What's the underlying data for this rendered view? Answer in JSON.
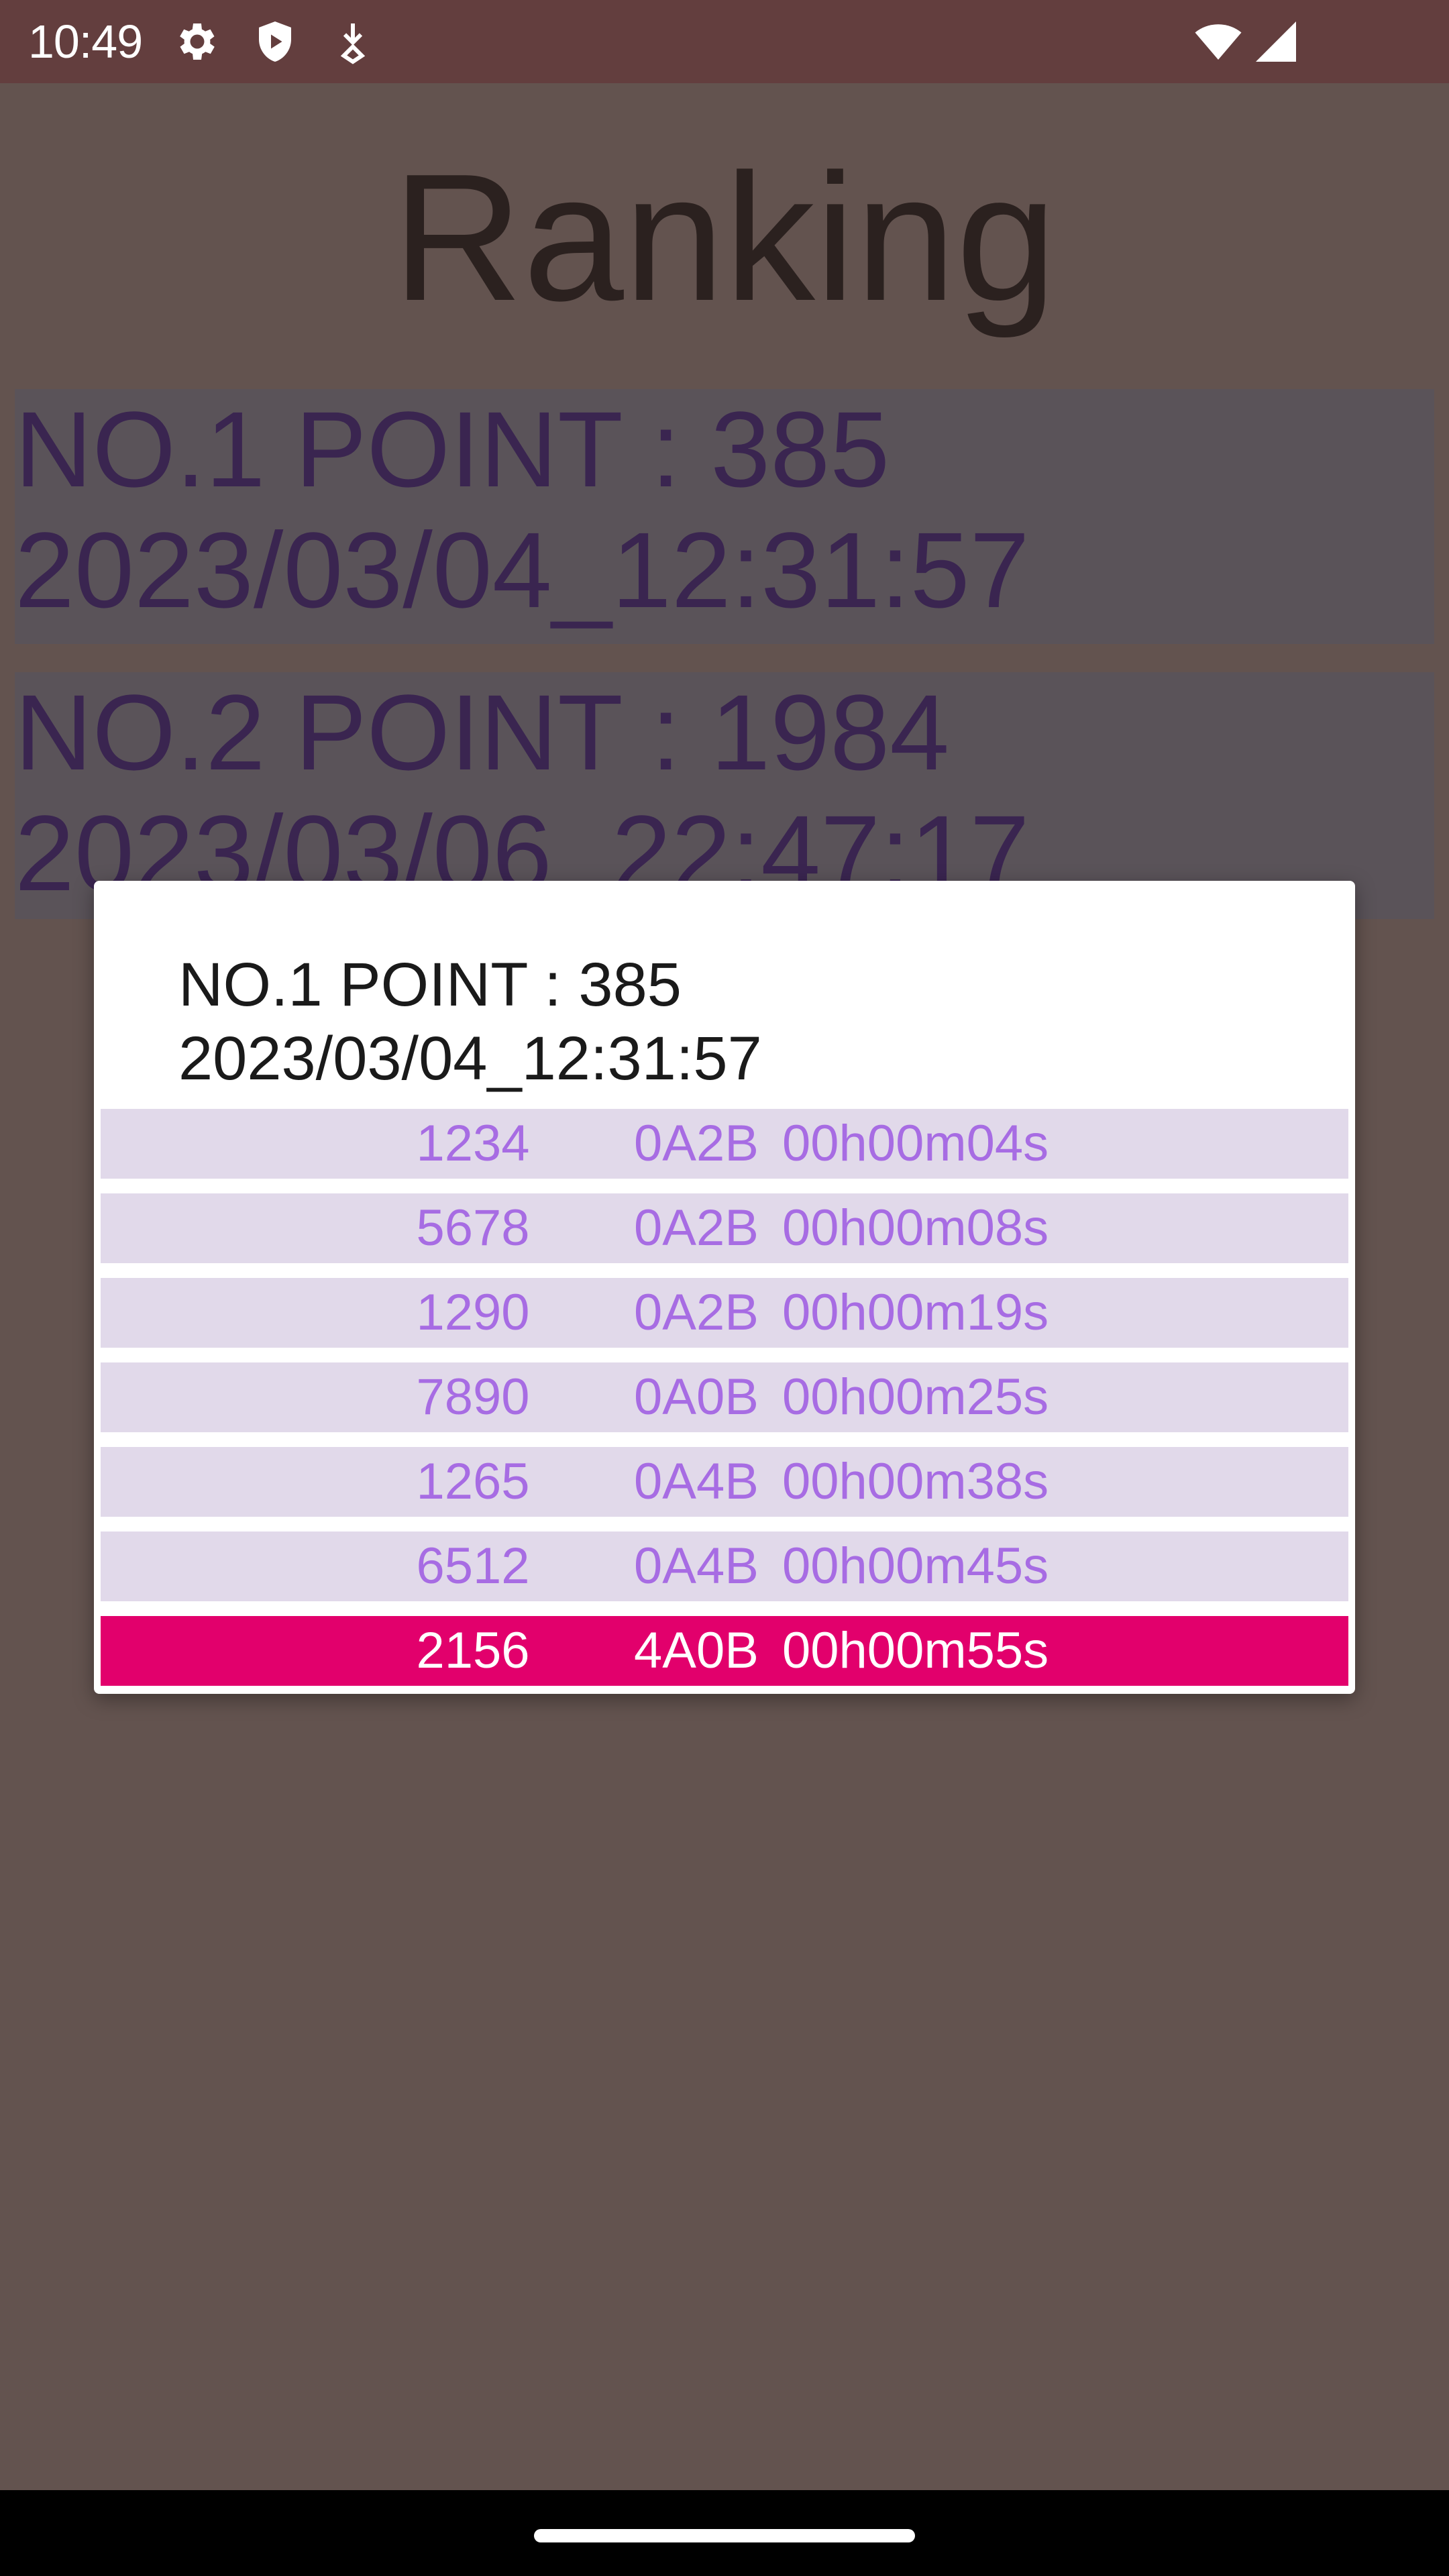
{
  "status_bar": {
    "time": "10:49",
    "left_icons": [
      "gear-icon",
      "shield-icon",
      "download-icon"
    ],
    "right_icons": [
      "wifi-icon",
      "signal-icon"
    ]
  },
  "app": {
    "title": "Ranking",
    "ranking_list": [
      {
        "line1": "NO.1 POINT : 385",
        "line2": "2023/03/04_12:31:57"
      },
      {
        "line1": "NO.2 POINT : 1984",
        "line2": "2023/03/06_22:47:17"
      }
    ]
  },
  "dialog": {
    "title_line1": "NO.1 POINT : 385",
    "title_line2": "2023/03/04_12:31:57",
    "rows": [
      {
        "id": "1234",
        "code": "0A2B",
        "time": "00h00m04s"
      },
      {
        "id": "5678",
        "code": "0A2B",
        "time": "00h00m08s"
      },
      {
        "id": "1290",
        "code": "0A2B",
        "time": "00h00m19s"
      },
      {
        "id": "7890",
        "code": "0A0B",
        "time": "00h00m25s"
      },
      {
        "id": "1265",
        "code": "0A4B",
        "time": "00h00m38s"
      },
      {
        "id": "6512",
        "code": "0A4B",
        "time": "00h00m45s"
      },
      {
        "id": "2156",
        "code": "4A0B",
        "time": "00h00m55s"
      }
    ],
    "selected_row_index": 6
  },
  "colors": {
    "status_bar": "#633e3e",
    "scrim_background": "#63534f",
    "row_background": "#e1d9ea",
    "row_text": "#a76ce3",
    "selected_row_background": "#e2006c",
    "selected_row_text": "#ffffff"
  }
}
